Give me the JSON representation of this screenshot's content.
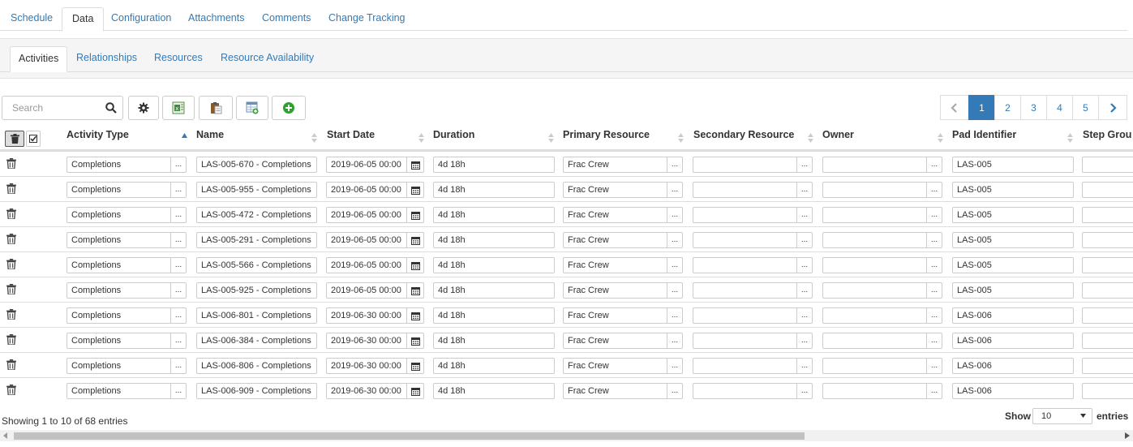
{
  "top_tabs": [
    "Schedule",
    "Data",
    "Configuration",
    "Attachments",
    "Comments",
    "Change Tracking"
  ],
  "sub_tabs": [
    "Activities",
    "Relationships",
    "Resources",
    "Resource Availability"
  ],
  "search": {
    "placeholder": "Search"
  },
  "pagination": {
    "pages": [
      "1",
      "2",
      "3",
      "4",
      "5"
    ],
    "active": "1"
  },
  "columns": [
    "Activity Type",
    "Name",
    "Start Date",
    "Duration",
    "Primary Resource",
    "Secondary Resource",
    "Owner",
    "Pad Identifier",
    "Step Grou"
  ],
  "rows": [
    {
      "activity_type": "Completions",
      "name": "LAS-005-670 - Completions",
      "start": "2019-06-05 00:00",
      "duration": "4d 18h",
      "primary": "Frac Crew",
      "secondary": "",
      "owner": "",
      "pad": "LAS-005",
      "step": ""
    },
    {
      "activity_type": "Completions",
      "name": "LAS-005-955 - Completions",
      "start": "2019-06-05 00:00",
      "duration": "4d 18h",
      "primary": "Frac Crew",
      "secondary": "",
      "owner": "",
      "pad": "LAS-005",
      "step": ""
    },
    {
      "activity_type": "Completions",
      "name": "LAS-005-472 - Completions",
      "start": "2019-06-05 00:00",
      "duration": "4d 18h",
      "primary": "Frac Crew",
      "secondary": "",
      "owner": "",
      "pad": "LAS-005",
      "step": ""
    },
    {
      "activity_type": "Completions",
      "name": "LAS-005-291 - Completions",
      "start": "2019-06-05 00:00",
      "duration": "4d 18h",
      "primary": "Frac Crew",
      "secondary": "",
      "owner": "",
      "pad": "LAS-005",
      "step": ""
    },
    {
      "activity_type": "Completions",
      "name": "LAS-005-566 - Completions",
      "start": "2019-06-05 00:00",
      "duration": "4d 18h",
      "primary": "Frac Crew",
      "secondary": "",
      "owner": "",
      "pad": "LAS-005",
      "step": ""
    },
    {
      "activity_type": "Completions",
      "name": "LAS-005-925 - Completions",
      "start": "2019-06-05 00:00",
      "duration": "4d 18h",
      "primary": "Frac Crew",
      "secondary": "",
      "owner": "",
      "pad": "LAS-005",
      "step": ""
    },
    {
      "activity_type": "Completions",
      "name": "LAS-006-801 - Completions",
      "start": "2019-06-30 00:00",
      "duration": "4d 18h",
      "primary": "Frac Crew",
      "secondary": "",
      "owner": "",
      "pad": "LAS-006",
      "step": ""
    },
    {
      "activity_type": "Completions",
      "name": "LAS-006-384 - Completions",
      "start": "2019-06-30 00:00",
      "duration": "4d 18h",
      "primary": "Frac Crew",
      "secondary": "",
      "owner": "",
      "pad": "LAS-006",
      "step": ""
    },
    {
      "activity_type": "Completions",
      "name": "LAS-006-806 - Completions",
      "start": "2019-06-30 00:00",
      "duration": "4d 18h",
      "primary": "Frac Crew",
      "secondary": "",
      "owner": "",
      "pad": "LAS-006",
      "step": ""
    },
    {
      "activity_type": "Completions",
      "name": "LAS-006-909 - Completions",
      "start": "2019-06-30 00:00",
      "duration": "4d 18h",
      "primary": "Frac Crew",
      "secondary": "",
      "owner": "",
      "pad": "LAS-006",
      "step": ""
    }
  ],
  "ellipsis": "...",
  "footer": {
    "info": "Showing 1 to 10 of 68 entries",
    "show_label": "Show",
    "page_size": "10",
    "entries_label": "entries"
  },
  "colors": {
    "link": "#337ab7",
    "active_page": "#337ab7",
    "border": "#dddddd"
  }
}
